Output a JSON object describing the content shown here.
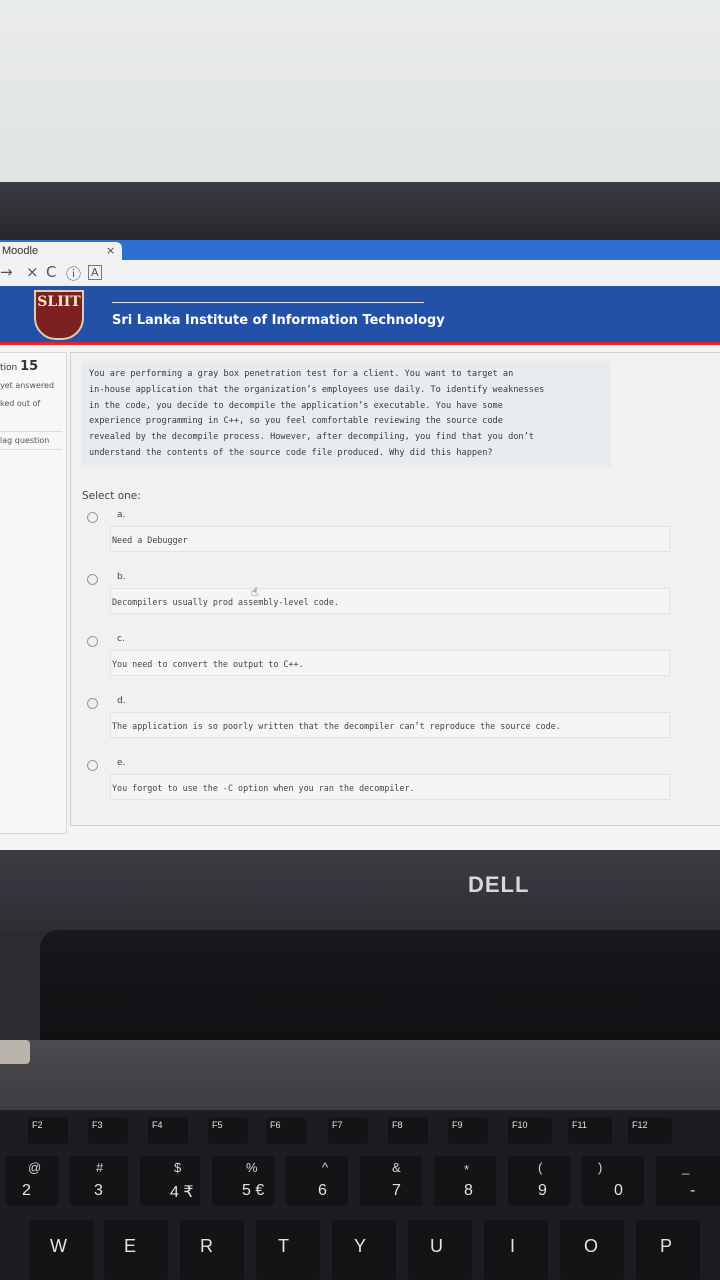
{
  "browser": {
    "tab_title": "Moodle",
    "tab_close": "×",
    "nav_back": "→",
    "nav_stop": "×",
    "nav_reload": "C",
    "nav_info": "ⓘ",
    "nav_reader": "A"
  },
  "header": {
    "logo_text": "SLIIT",
    "institute_name": "Sri Lanka Institute of Information Technology"
  },
  "question_info": {
    "label": "tion",
    "number": "15",
    "state": "yet answered",
    "marks": "ked out of",
    "flag": "lag question"
  },
  "question": {
    "lines": [
      "You are performing a gray box penetration test for a client. You want to target an",
      "in-house application that the organization’s employees use daily. To identify weaknesses",
      "in the code, you decide to decompile the application’s executable. You have some",
      "experience programming in C++, so you feel comfortable reviewing the source code",
      "revealed by the decompile process. However, after decompiling, you find that you don’t",
      "understand the contents of the source code file produced. Why did this happen?"
    ],
    "select_label": "Select one:",
    "options": [
      {
        "letter": "a.",
        "text": "Need a Debugger"
      },
      {
        "letter": "b.",
        "text": "Decompilers usually prod   assembly-level code."
      },
      {
        "letter": "c.",
        "text": "You need to convert the output to C++."
      },
      {
        "letter": "d.",
        "text": "The application is so poorly written that the decompiler can’t reproduce the source code."
      },
      {
        "letter": "e.",
        "text": "You forgot to use the -C option when you ran the decompiler."
      }
    ]
  },
  "laptop": {
    "brand": "DELL"
  },
  "keyboard": {
    "fkeys": [
      "F2",
      "F3",
      "F4",
      "F5",
      "F6",
      "F7",
      "F8",
      "F9",
      "F10",
      "F11",
      "F12"
    ],
    "shift_symbols": [
      "@",
      "#",
      "$",
      "%",
      "^",
      "&",
      "*",
      "(",
      ")",
      "_"
    ],
    "number_keys": [
      "2",
      "3",
      "4 ₹",
      "5 €",
      "6",
      "7",
      "8",
      "9",
      "0",
      "-"
    ],
    "letter_keys": [
      "W",
      "E",
      "R",
      "T",
      "Y",
      "U",
      "I",
      "O",
      "P"
    ]
  }
}
